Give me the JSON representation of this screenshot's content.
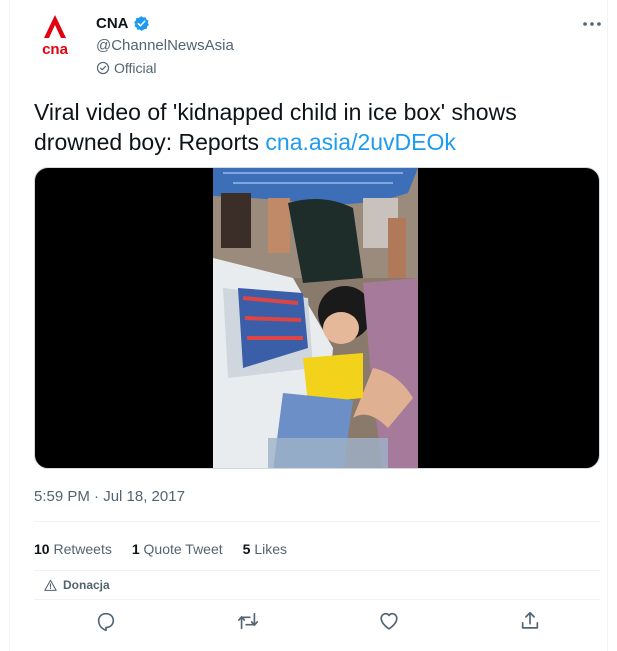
{
  "account": {
    "name": "CNA",
    "handle": "@ChannelNewsAsia",
    "official_label": "Official",
    "avatar_text": "cna",
    "brand_color": "#e3000f",
    "verified_color": "#1d9bf0"
  },
  "tweet": {
    "text": "Viral video of 'kidnapped child in ice box' shows drowned boy: Reports ",
    "link": "cna.asia/2uvDEOk",
    "timestamp": "5:59 PM · Jul 18, 2017"
  },
  "stats": {
    "retweets_count": "10",
    "retweets_label": "Retweets",
    "quotes_count": "1",
    "quotes_label": "Quote Tweet",
    "likes_count": "5",
    "likes_label": "Likes"
  },
  "donation_label": "Donacja",
  "icons": {
    "more": "more-icon",
    "reply": "reply-icon",
    "retweet": "retweet-icon",
    "like": "heart-icon",
    "share": "share-icon"
  }
}
